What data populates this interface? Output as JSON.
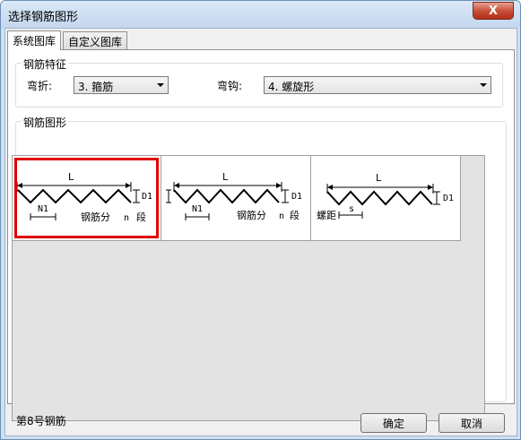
{
  "window": {
    "title": "选择钢筋图形",
    "close_label": "X"
  },
  "tabs": [
    {
      "label": "系统图库",
      "active": true
    },
    {
      "label": "自定义图库",
      "active": false
    }
  ],
  "features": {
    "title": "钢筋特征",
    "bend_label": "弯折:",
    "bend_value": "3. 箍筋",
    "hook_label": "弯钩:",
    "hook_value": "4. 螺旋形"
  },
  "shapes": {
    "title": "钢筋图形",
    "items": [
      {
        "label_L": "L",
        "label_D": "D1",
        "label_N": "N1",
        "caption": "钢筋分",
        "n_label": "n",
        "seg_label": "段",
        "selected": true
      },
      {
        "label_L": "L",
        "label_D": "D1",
        "label_N": "N1",
        "caption": "钢筋分",
        "n_label": "n",
        "seg_label": "段",
        "selected": false
      },
      {
        "label_L": "L",
        "label_D": "D1",
        "label_pitch": "螺距",
        "label_s": "s",
        "selected": false
      }
    ]
  },
  "status_text": "第8号钢筋",
  "buttons": {
    "ok": "确定",
    "cancel": "取消"
  },
  "colors": {
    "selection": "#e00000",
    "title_bar": "#c3d7ee",
    "close_button": "#c74b35"
  }
}
